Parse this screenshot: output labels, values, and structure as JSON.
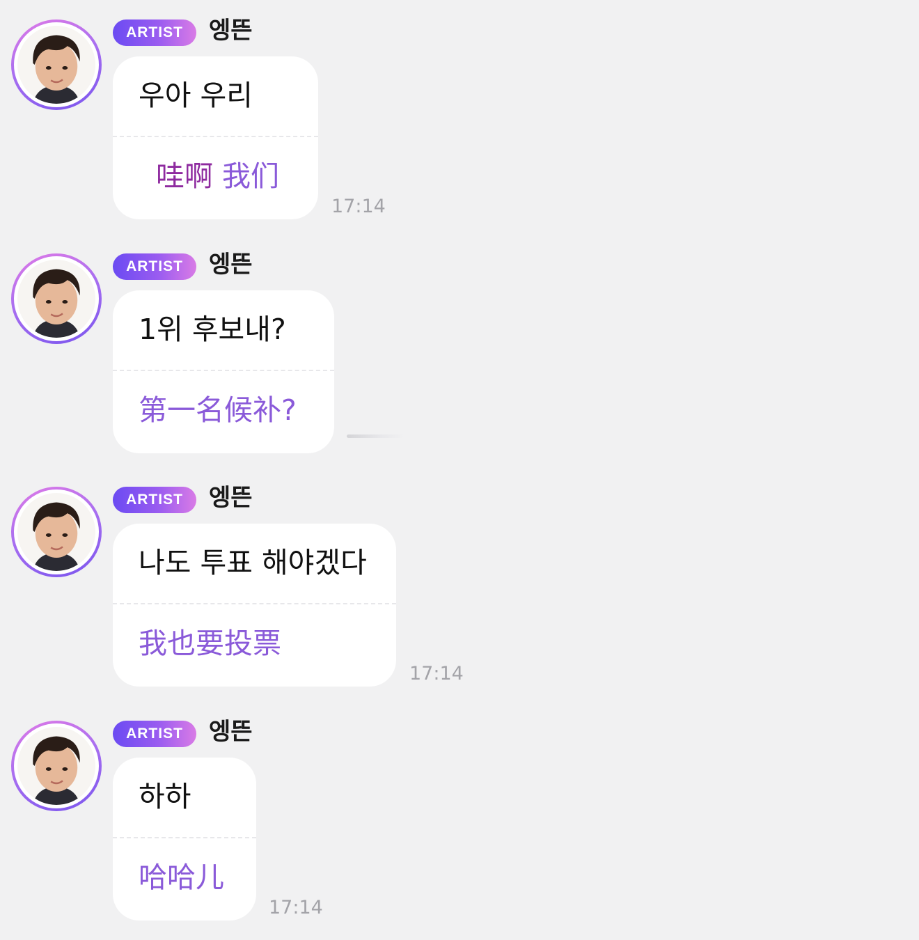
{
  "badge_label": "ARTIST",
  "colors": {
    "background": "#f1f1f2",
    "bubble": "#ffffff",
    "translation_text": "#8a5ad9",
    "badge_gradient_start": "#6b4bf2",
    "badge_gradient_end": "#d97be6",
    "timestamp": "#a3a3a8"
  },
  "messages": [
    {
      "sender": "엥뜬",
      "badge": "ARTIST",
      "original": "우아 우리",
      "translation_part1": "哇啊",
      "translation_part2": "我们",
      "time": "17:14"
    },
    {
      "sender": "엥뜬",
      "badge": "ARTIST",
      "original": "1위 후보내?",
      "translation_part1": "第一名候补?",
      "translation_part2": "",
      "time": ""
    },
    {
      "sender": "엥뜬",
      "badge": "ARTIST",
      "original": "나도 투표 해야겠다",
      "translation_part1": "我也要投票",
      "translation_part2": "",
      "time": "17:14"
    },
    {
      "sender": "엥뜬",
      "badge": "ARTIST",
      "original": "하하",
      "translation_part1": "哈哈儿",
      "translation_part2": "",
      "time": "17:14"
    }
  ]
}
